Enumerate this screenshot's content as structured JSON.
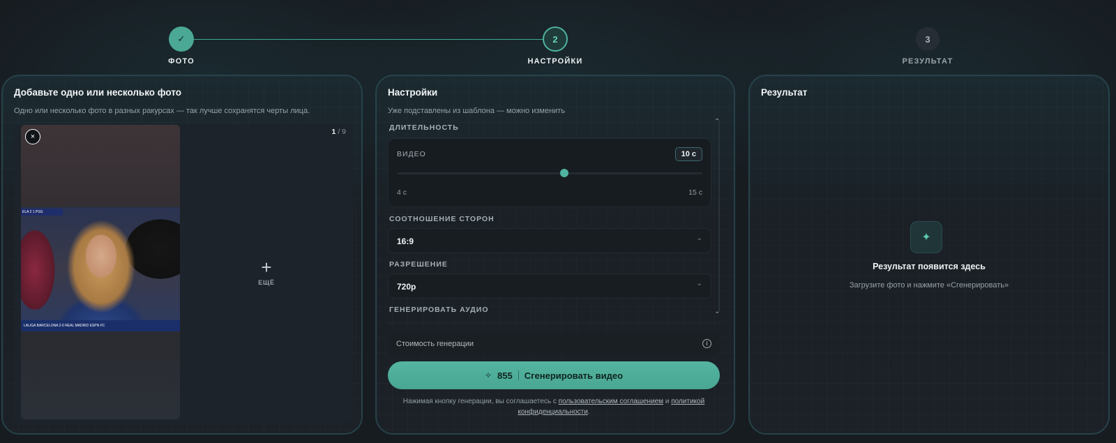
{
  "stepper": {
    "steps": [
      {
        "number": "✓",
        "label": "ФОТО",
        "state": "done"
      },
      {
        "number": "2",
        "label": "НАСТРОЙКИ",
        "state": "active"
      },
      {
        "number": "3",
        "label": "РЕЗУЛЬТАТ",
        "state": "todo"
      }
    ]
  },
  "photos": {
    "title": "Добавьте одно или несколько фото",
    "subtitle": "Одно или несколько фото в разных ракурсах — так лучше сохранятся черты лица.",
    "counter_current": "1",
    "counter_total": "/ 9",
    "close_icon": "×",
    "add_icon": "+",
    "add_label": "ЕЩЁ",
    "scoreboard_text": "ELA 2 1 PSG",
    "ticker_text": "LALIGA  BARCELONA 2-0 REAL MADRID  ESPN FC"
  },
  "settings": {
    "title": "Настройки",
    "subtitle": "Уже подставлены из шаблона — можно изменить",
    "duration_label": "ДЛИТЕЛЬНОСТЬ",
    "video": {
      "label": "ВИДЕО",
      "value": "10 с",
      "min_label": "4 с",
      "max_label": "15 с",
      "min": 4,
      "max": 15,
      "current": 10
    },
    "aspect_label": "СООТНОШЕНИЕ СТОРОН",
    "aspect_value": "16:9",
    "resolution_label": "РАЗРЕШЕНИЕ",
    "resolution_value": "720p",
    "audio_label": "ГЕНЕРИРОВАТЬ АУДИО",
    "chevron": "⌄",
    "scroll_up": "⌃",
    "scroll_down": "⌄",
    "cost_label": "Стоимость генерации",
    "info_icon": "i",
    "generate": {
      "sparkle": "✧",
      "cost": "855",
      "label": "Сгенерировать видео"
    },
    "terms": {
      "prefix": "Нажимая кнопку генерации, вы соглашаетесь с ",
      "link1": "пользовательским соглашением",
      "middle": " и ",
      "link2": "политикой конфиденциальности",
      "suffix": "."
    }
  },
  "result": {
    "title": "Результат",
    "icon": "✦",
    "placeholder_title": "Результат появится здесь",
    "placeholder_desc": "Загрузите фото и нажмите «Сгенерировать»"
  },
  "colors": {
    "accent": "#4fb39f",
    "background": "#171c21",
    "panel_border": "#26424a"
  }
}
